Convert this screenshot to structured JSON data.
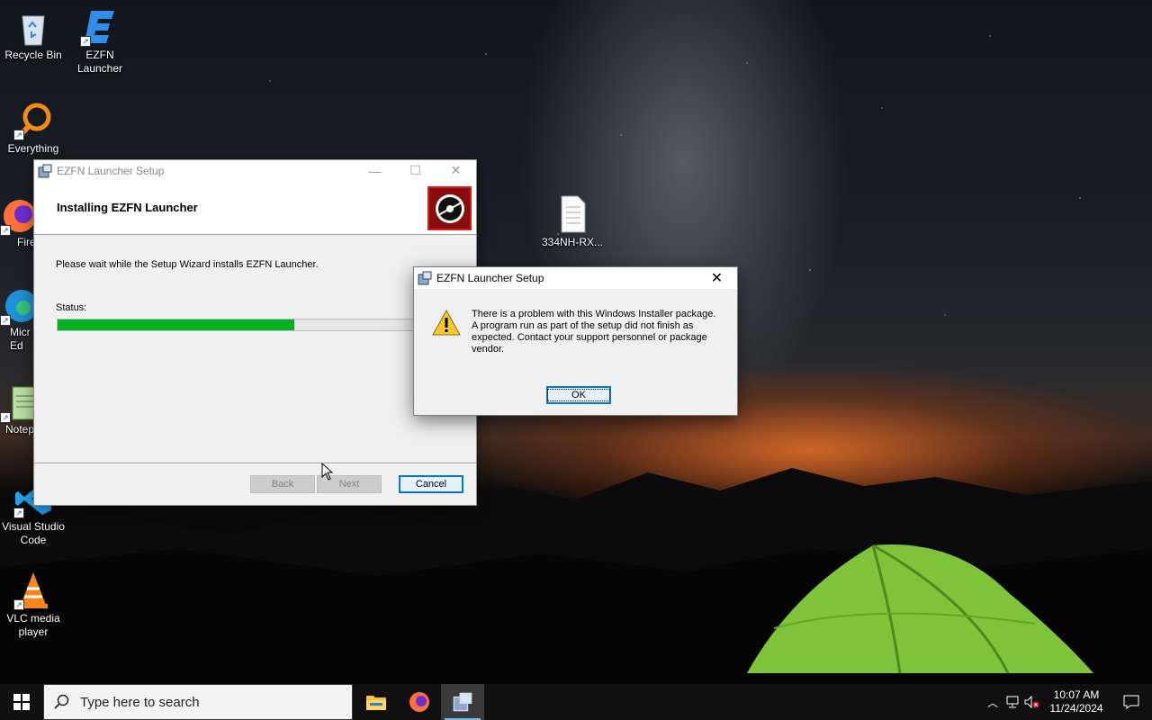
{
  "desktop": {
    "icons": [
      {
        "label": "Recycle Bin",
        "icon": "recycle-bin-icon"
      },
      {
        "label": "EZFN Launcher",
        "icon": "ezfn-icon"
      },
      {
        "label": "Everything",
        "icon": "everything-search-icon"
      },
      {
        "label": "Fire",
        "icon": "firefox-icon"
      },
      {
        "label": "Micr Ed",
        "icon": "edge-icon"
      },
      {
        "label": "Notep",
        "icon": "notepad-icon"
      },
      {
        "label": "Visual Studio Code",
        "icon": "vscode-icon"
      },
      {
        "label": "VLC media player",
        "icon": "vlc-icon"
      },
      {
        "label": "334NH-RX...",
        "icon": "document-icon"
      }
    ]
  },
  "setup_window": {
    "title": "EZFN Launcher Setup",
    "heading": "Installing EZFN Launcher",
    "message": "Please wait while the Setup Wizard installs EZFN Launcher.",
    "status_label": "Status:",
    "progress": 0.6,
    "buttons": {
      "back": "Back",
      "next": "Next",
      "cancel": "Cancel"
    }
  },
  "error_dialog": {
    "title": "EZFN Launcher Setup",
    "message_lines": [
      "There is a problem with this Windows Installer package.",
      "A program run as part of the setup did not finish as",
      "expected. Contact your support personnel or package",
      "vendor."
    ],
    "ok_label": "OK",
    "close_glyph": "✕"
  },
  "taskbar": {
    "search_placeholder": "Type here to search",
    "time": "10:07 AM",
    "date": "11/24/2024",
    "accent": "#76b9ed"
  }
}
